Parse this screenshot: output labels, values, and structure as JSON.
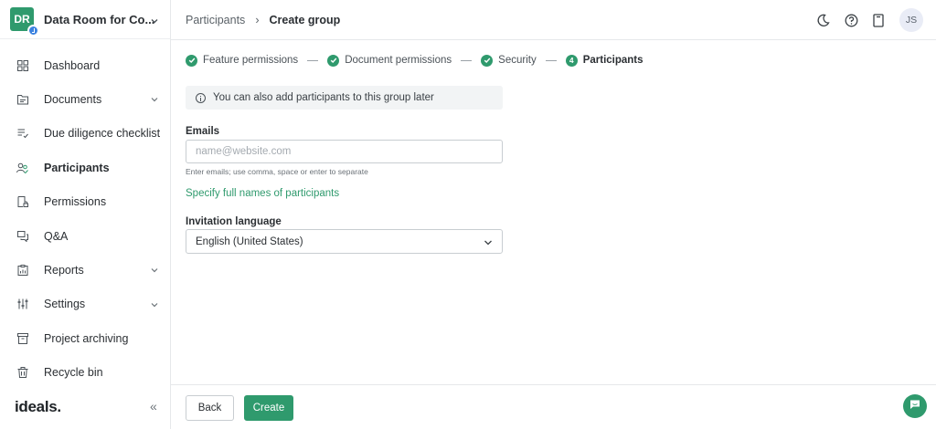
{
  "project": {
    "initials": "DR",
    "name": "Data Room for Co..."
  },
  "sidebar": {
    "items": [
      {
        "label": "Dashboard",
        "icon": "dashboard-icon"
      },
      {
        "label": "Documents",
        "icon": "documents-icon",
        "expandable": true
      },
      {
        "label": "Due diligence checklist",
        "icon": "checklist-icon"
      },
      {
        "label": "Participants",
        "icon": "participants-icon",
        "active": true
      },
      {
        "label": "Permissions",
        "icon": "permissions-icon"
      },
      {
        "label": "Q&A",
        "icon": "qa-icon"
      },
      {
        "label": "Reports",
        "icon": "reports-icon",
        "expandable": true
      },
      {
        "label": "Settings",
        "icon": "settings-icon",
        "expandable": true
      },
      {
        "label": "Project archiving",
        "icon": "archive-icon"
      },
      {
        "label": "Recycle bin",
        "icon": "trash-icon"
      }
    ],
    "logo": "ideals.",
    "collapse": "«"
  },
  "header": {
    "breadcrumb_parent": "Participants",
    "breadcrumb_separator": "›",
    "breadcrumb_current": "Create group",
    "user_initials": "JS"
  },
  "steps": [
    {
      "label": "Feature permissions",
      "state": "done"
    },
    {
      "label": "Document permissions",
      "state": "done"
    },
    {
      "label": "Security",
      "state": "done"
    },
    {
      "label": "Participants",
      "state": "current",
      "number": "4"
    }
  ],
  "form": {
    "info_text": "You can also add participants to this group later",
    "emails_label": "Emails",
    "emails_placeholder": "name@website.com",
    "emails_hint": "Enter emails; use comma, space or enter to separate",
    "full_names_link": "Specify full names of participants",
    "language_label": "Invitation language",
    "language_value": "English (United States)"
  },
  "footer": {
    "back_label": "Back",
    "create_label": "Create"
  },
  "colors": {
    "accent": "#2f9a6d",
    "text": "#2b2f33",
    "border": "#c8cdd1"
  }
}
